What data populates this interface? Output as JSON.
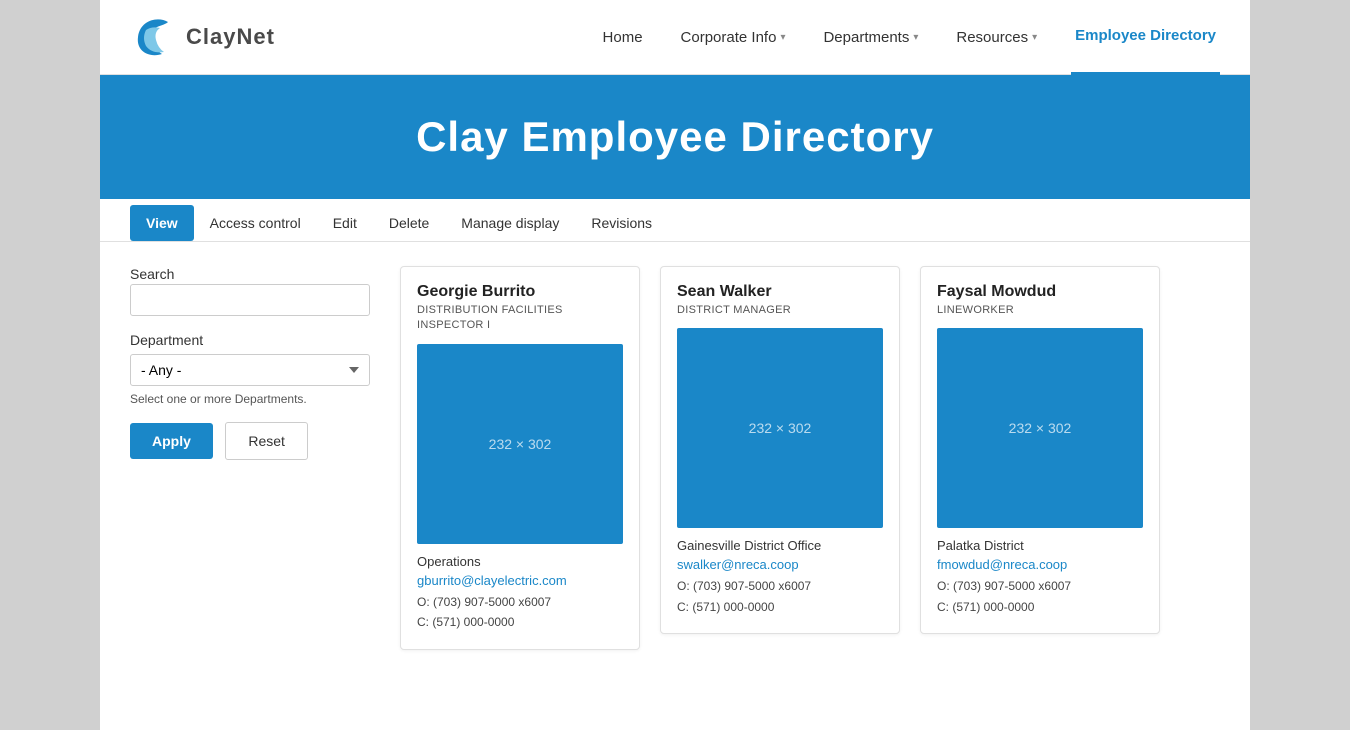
{
  "brand": {
    "logo_text": "ClayNet",
    "logo_alt": "ClayNet logo"
  },
  "navbar": {
    "links": [
      {
        "label": "Home",
        "active": false,
        "has_dropdown": false
      },
      {
        "label": "Corporate Info",
        "active": false,
        "has_dropdown": true
      },
      {
        "label": "Departments",
        "active": false,
        "has_dropdown": true
      },
      {
        "label": "Resources",
        "active": false,
        "has_dropdown": true
      },
      {
        "label": "Employee Directory",
        "active": true,
        "has_dropdown": false
      }
    ]
  },
  "hero": {
    "title": "Clay Employee Directory"
  },
  "subnav": {
    "tabs": [
      {
        "label": "View",
        "active": true
      },
      {
        "label": "Access control",
        "active": false
      },
      {
        "label": "Edit",
        "active": false
      },
      {
        "label": "Delete",
        "active": false
      },
      {
        "label": "Manage display",
        "active": false
      },
      {
        "label": "Revisions",
        "active": false
      }
    ]
  },
  "filter": {
    "search_label": "Search",
    "search_placeholder": "",
    "dept_label": "Department",
    "dept_default": "- Any -",
    "dept_hint": "Select one or more Departments.",
    "apply_label": "Apply",
    "reset_label": "Reset"
  },
  "employees": [
    {
      "name": "Georgie Burrito",
      "title": "DISTRIBUTION FACILITIES INSPECTOR I",
      "photo_text": "232 × 302",
      "office": "Operations",
      "email": "gburrito@clayelectric.com",
      "phone_o": "O: (703) 907-5000 x6007",
      "phone_c": "C: (571) 000-0000"
    },
    {
      "name": "Sean Walker",
      "title": "DISTRICT MANAGER",
      "photo_text": "232 × 302",
      "office": "Gainesville District Office",
      "email": "swalker@nreca.coop",
      "phone_o": "O: (703) 907-5000 x6007",
      "phone_c": "C: (571) 000-0000"
    },
    {
      "name": "Faysal Mowdud",
      "title": "LINEWORKER",
      "photo_text": "232 × 302",
      "office": "Palatka District",
      "email": "fmowdud@nreca.coop",
      "phone_o": "O: (703) 907-5000 x6007",
      "phone_c": "C: (571) 000-0000"
    }
  ]
}
